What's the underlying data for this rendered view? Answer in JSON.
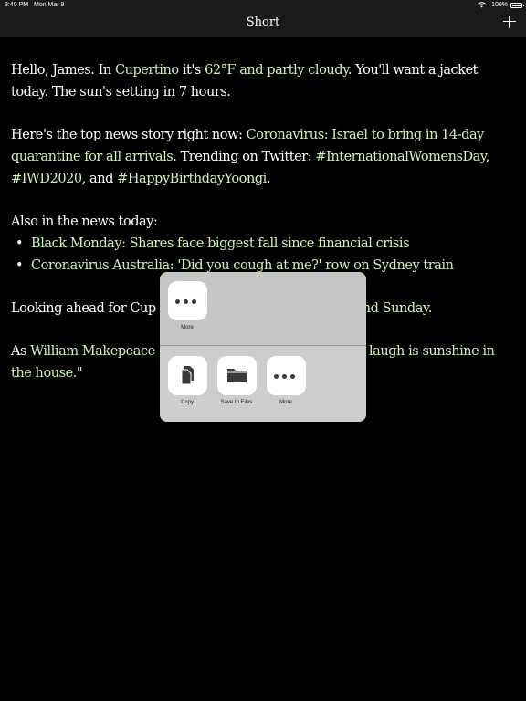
{
  "status_bar": {
    "time": "3:40 PM",
    "date": "Mon Mar 9",
    "battery": "100%",
    "battery_level": 1.0
  },
  "nav": {
    "title": "Short"
  },
  "content": {
    "greeting": {
      "hello": "Hello, James. In ",
      "city": "Cupertino",
      "its": " it's ",
      "weather": "62°F and partly cloudy",
      "jacket": ". You'll want a jacket today. The sun's setting in 7 hours."
    },
    "news": {
      "intro": "Here's the top news story right now: ",
      "story": "Coronavirus: Israel to bring in 14-day quarantine for all arrivals",
      "trending": ". Trending on Twitter: ",
      "tag1": "#InternationalWomensDay",
      "sep1": ", ",
      "tag2": "#IWD2020",
      "sep2": ", and ",
      "tag3": "#HappyBirthdayYoongi",
      "end": "."
    },
    "also": {
      "heading": "Also in the news today:",
      "items": [
        "Black Monday: Shares face biggest fall since financial crisis",
        "Coronavirus Australia: 'Did you cough at me?' row on Sydney train"
      ]
    },
    "looking": {
      "start": "Looking ahead for Cup",
      "end": "nd Sunday."
    },
    "quote": {
      "as": "As ",
      "author": "William Makepeace",
      "rest": " laugh is sunshine in the house.\""
    }
  },
  "share_sheet": {
    "top_actions": [
      {
        "label": "More",
        "icon": "more-icon"
      }
    ],
    "bottom_actions": [
      {
        "label": "Copy",
        "icon": "copy-icon"
      },
      {
        "label": "Save to Files",
        "icon": "folder-icon"
      },
      {
        "label": "More",
        "icon": "more-icon"
      }
    ]
  }
}
